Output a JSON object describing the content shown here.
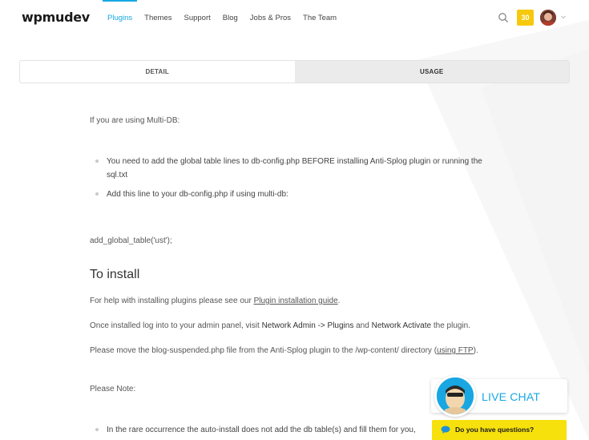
{
  "header": {
    "logo": "wpmudev",
    "nav": [
      {
        "label": "Plugins",
        "active": true
      },
      {
        "label": "Themes",
        "active": false
      },
      {
        "label": "Support",
        "active": false
      },
      {
        "label": "Blog",
        "active": false
      },
      {
        "label": "Jobs & Pros",
        "active": false
      },
      {
        "label": "The Team",
        "active": false
      }
    ],
    "notification_count": "30",
    "icons": {
      "search": "search-icon",
      "caret": "chevron-down-icon"
    },
    "accent_color": "#17a8e3",
    "badge_color": "#f6c90e"
  },
  "tabs": [
    {
      "label": "DETAIL",
      "active": false
    },
    {
      "label": "USAGE",
      "active": true
    }
  ],
  "content": {
    "multidb_intro": "If you are using Multi-DB:",
    "multidb_bullets": [
      "You need to add the global table lines to db-config.php BEFORE installing Anti-Splog plugin or running the sql.txt",
      "Add this line to your db-config.php if using multi-db:"
    ],
    "code_line": "add_global_table('ust');",
    "install_heading": "To install",
    "help": {
      "prefix": "For help with installing plugins please see our ",
      "link": "Plugin installation guide",
      "suffix": "."
    },
    "installed": {
      "prefix": "Once installed log into to your admin panel, visit ",
      "strong1": "Network Admin -> Plugins",
      "middle": " and ",
      "strong2": "Network Activate",
      "suffix": " the plugin."
    },
    "move_file": {
      "prefix": "Please move the blog-suspended.php file from the Anti-Splog plugin to the /wp-content/ directory (",
      "link": "using FTP",
      "suffix": ")."
    },
    "note": "Please Note:",
    "note_bullet": "In the rare occurrence the auto-install does not add the db table(s) and fill them for you,"
  },
  "chat": {
    "label": "LIVE CHAT",
    "question": "Do you have questions?",
    "question_bg": "#f6e10c"
  }
}
